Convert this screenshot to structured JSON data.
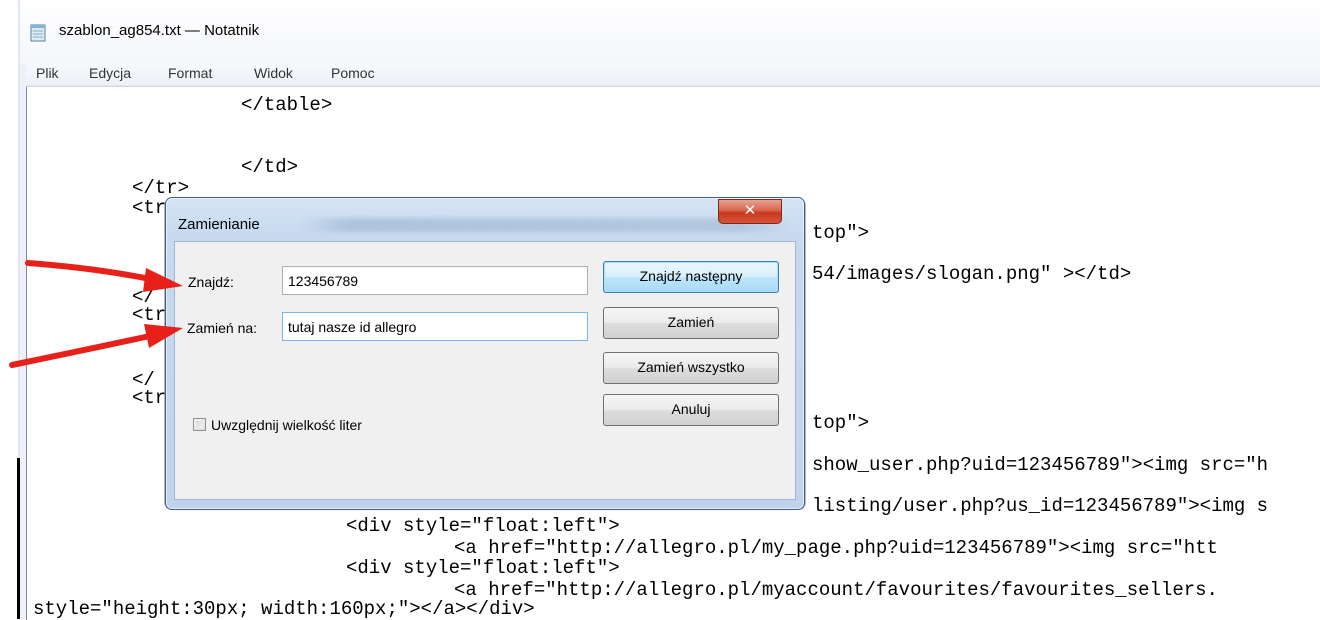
{
  "window": {
    "title": "szablon_ag854.txt — Notatnik",
    "icon": "notepad-icon"
  },
  "menu": [
    "Plik",
    "Edycja",
    "Format",
    "Widok",
    "Pomoc"
  ],
  "editor": {
    "lines": [
      "</table>",
      "</td>",
      "</tr>",
      "<tr",
      "top\">",
      "54/images/slogan.png\" ></td>",
      "</",
      "<tr",
      "</",
      "<tr",
      "top\">",
      "show_user.php?uid=123456789\"><img src=\"h",
      "listing/user.php?us_id=123456789\"><img s",
      "<div style=\"float:left\">",
      "<a href=\"http://allegro.pl/my_page.php?uid=123456789\"><img src=\"htt",
      "<div style=\"float:left\">",
      "<a href=\"http://allegro.pl/myaccount/favourites/favourites_sellers.",
      "style=\"height:30px; width:160px;\"></a></div>"
    ]
  },
  "dialog": {
    "title": "Zamienianie",
    "find_label": "Znajdź:",
    "find_value": "123456789",
    "replace_label": "Zamień na:",
    "replace_value": "tutaj nasze id allegro",
    "find_next_button": "Znajdź następny",
    "replace_button": "Zamień",
    "replace_all_button": "Zamień wszystko",
    "cancel_button": "Anuluj",
    "match_case_label": "Uwzględnij wielkość liter",
    "match_case_checked": false,
    "close_icon": "close-icon"
  },
  "colors": {
    "arrow": "#e8201a",
    "dialog_frame": "#c6d9ef",
    "close_button": "#c8391f"
  }
}
